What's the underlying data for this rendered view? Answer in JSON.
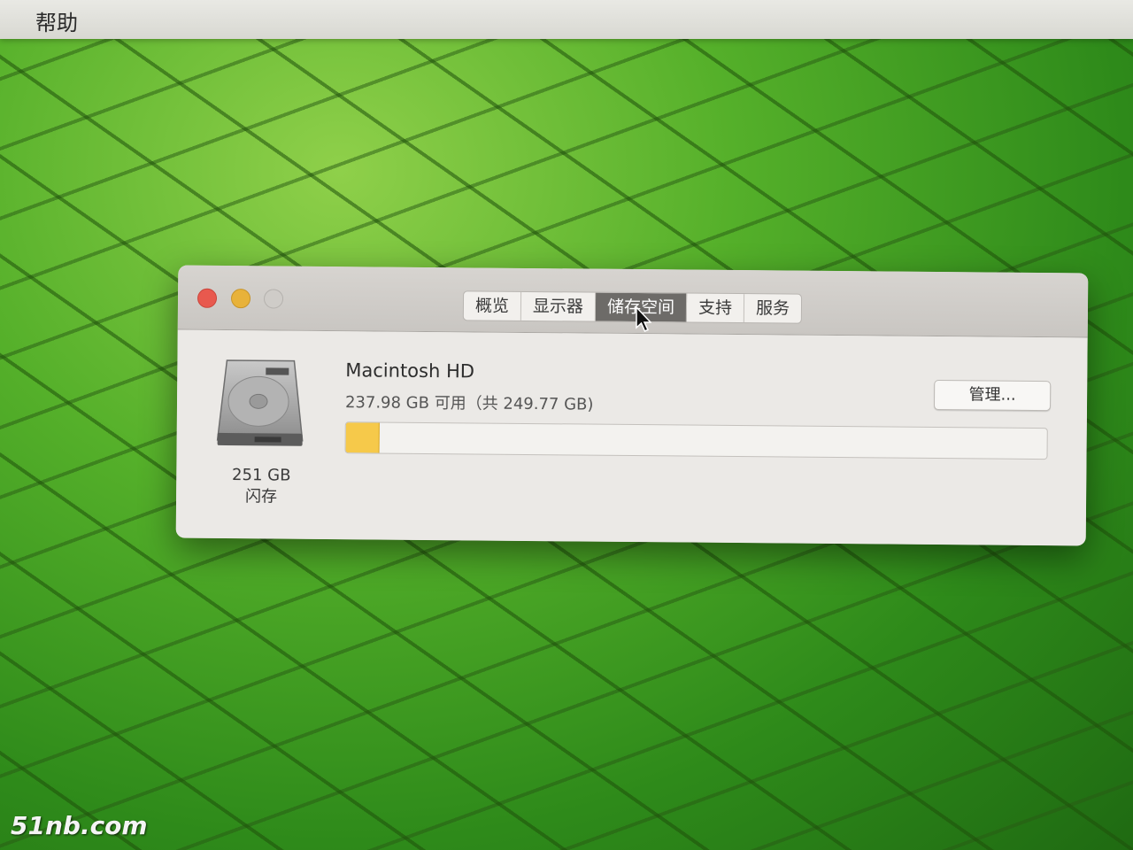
{
  "menubar": {
    "items": [
      "帮助"
    ]
  },
  "window": {
    "tabs": [
      {
        "label": "概览",
        "active": false
      },
      {
        "label": "显示器",
        "active": false
      },
      {
        "label": "储存空间",
        "active": true
      },
      {
        "label": "支持",
        "active": false
      },
      {
        "label": "服务",
        "active": false
      }
    ]
  },
  "storage": {
    "capacity": "251 GB",
    "type": "闪存",
    "volume_name": "Macintosh HD",
    "space_text": "237.98 GB 可用（共 249.77 GB)",
    "available_gb": 237.98,
    "total_gb": 249.77,
    "used_fraction": 0.047,
    "used_color": "#f6c94a",
    "manage_label": "管理..."
  },
  "watermark": "51nb.com",
  "colors": {
    "close": "#e8594e",
    "minimize": "#e8b23a",
    "zoom_disabled": "#cfccc8",
    "active_tab": "#6d6b68"
  },
  "icons": {
    "drive": "hard-drive-icon",
    "pointer": "arrow-cursor-icon"
  }
}
